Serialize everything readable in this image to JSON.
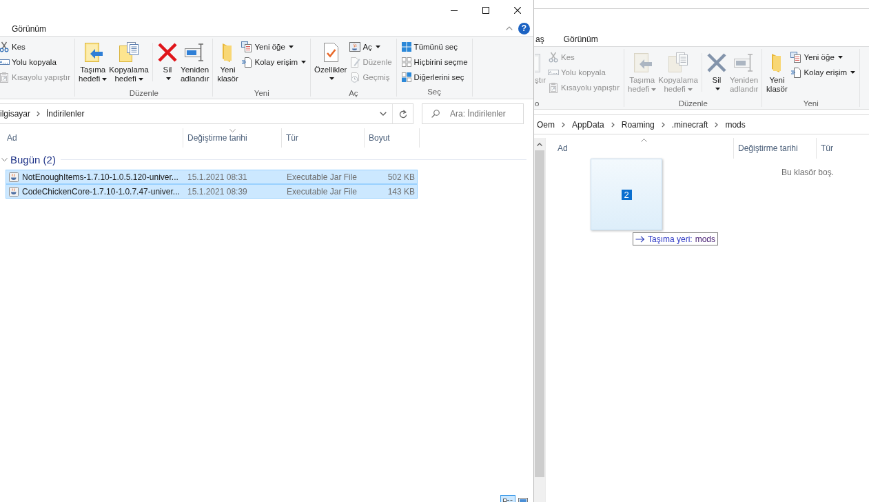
{
  "left_window": {
    "tabs": [
      {
        "label": "Görünüm",
        "selected": false
      }
    ],
    "help_button": {
      "glyph": "?"
    },
    "ribbon": [
      {
        "items": [
          {
            "label": "Kes",
            "kind": "cut",
            "dropdown": false,
            "disabled": false
          },
          {
            "label": "Yolu kopyala",
            "kind": "copypath",
            "dropdown": false,
            "disabled": false
          },
          {
            "label": "Kısayolu yapıştır",
            "kind": "pasteshortcut",
            "dropdown": false,
            "disabled": true
          }
        ]
      },
      {
        "label": "Düzenle",
        "items": [
          {
            "label": "Taşıma hedefi",
            "kind": "moveto",
            "dropdown": true,
            "disabled": false
          },
          {
            "label": "Kopyalama hedefi",
            "kind": "copyto",
            "dropdown": true,
            "disabled": false
          },
          {
            "kind": "separator"
          },
          {
            "label": "Sil",
            "kind": "delete",
            "dropdown": true,
            "disabled": false,
            "icon_disabled": false
          },
          {
            "label": "Yeniden adlandır",
            "kind": "rename",
            "dropdown": false,
            "disabled": false
          }
        ]
      },
      {
        "label": "Yeni",
        "items": [
          {
            "label": "Yeni klasör",
            "kind": "newfolder",
            "dropdown": false,
            "disabled": false
          },
          {
            "label": "Yeni öğe",
            "kind": "newitem",
            "dropdown": true,
            "disabled": false
          },
          {
            "label": "Kolay erişim",
            "kind": "easyaccess",
            "dropdown": true,
            "disabled": false
          }
        ]
      },
      {
        "label": "Aç",
        "items": [
          {
            "label": "Özellikler",
            "kind": "properties",
            "dropdown": true,
            "disabled": false
          },
          {
            "label": "Aç",
            "kind": "open",
            "dropdown": true,
            "disabled": false
          },
          {
            "label": "Düzenle",
            "kind": "edit",
            "dropdown": false,
            "disabled": true
          },
          {
            "label": "Geçmiş",
            "kind": "history",
            "dropdown": false,
            "disabled": true
          }
        ]
      },
      {
        "label": "Seç",
        "items": [
          {
            "label": "Tümünü seç",
            "kind": "selectall",
            "dropdown": false,
            "disabled": false
          },
          {
            "label": "Hiçbirini seçme",
            "kind": "selectnone",
            "dropdown": false,
            "disabled": false
          },
          {
            "label": "Diğerlerini seç",
            "kind": "invertselection",
            "dropdown": false,
            "disabled": false
          }
        ]
      }
    ],
    "address": {
      "path": [
        "ilgisayar",
        "İndirilenler"
      ]
    },
    "search": {
      "placeholder": "Ara: İndirilenler"
    },
    "columns": [
      {
        "label": "Ad",
        "sorted": false
      },
      {
        "label": "Değiştirme tarihi",
        "sorted": true,
        "ascending": false
      },
      {
        "label": "Tür",
        "sorted": false
      },
      {
        "label": "Boyut",
        "sorted": false
      }
    ],
    "groups": [
      {
        "label": "Bugün (2)",
        "expanded": true,
        "rows": [
          {
            "name": "NotEnoughItems-1.7.10-1.0.5.120-univer...",
            "modified": "15.1.2021 08:31",
            "type": "Executable Jar File",
            "size": "502 KB",
            "selected": true
          },
          {
            "name": "CodeChickenCore-1.7.10-1.0.7.47-univer...",
            "modified": "15.1.2021 08:39",
            "type": "Executable Jar File",
            "size": "143 KB",
            "selected": true
          }
        ]
      }
    ],
    "view_buttons": [
      {
        "kind": "details",
        "selected": true
      },
      {
        "kind": "largeicons",
        "selected": false
      }
    ]
  },
  "right_window": {
    "tabs": [
      {
        "label": "aş",
        "selected": false
      },
      {
        "label": "Görünüm",
        "selected": false
      }
    ],
    "ribbon": [
      {
        "label": "o",
        "items": [
          {
            "label": "ştır",
            "kind": "paste",
            "dropdown": false,
            "disabled": true
          },
          {
            "label": "Kes",
            "kind": "cut",
            "dropdown": false,
            "disabled": true
          },
          {
            "label": "Yolu kopyala",
            "kind": "copypath",
            "dropdown": false,
            "disabled": true
          },
          {
            "label": "Kısayolu yapıştır",
            "kind": "pasteshortcut",
            "dropdown": false,
            "disabled": true
          }
        ]
      },
      {
        "label": "Düzenle",
        "items": [
          {
            "label": "Taşıma hedefi",
            "kind": "moveto",
            "dropdown": true,
            "disabled": true
          },
          {
            "label": "Kopyalama hedefi",
            "kind": "copyto",
            "dropdown": true,
            "disabled": true
          },
          {
            "kind": "separator"
          },
          {
            "label": "Sil",
            "kind": "delete",
            "dropdown": true,
            "disabled": false,
            "icon_disabled": true
          },
          {
            "label": "Yeniden adlandır",
            "kind": "rename",
            "dropdown": false,
            "disabled": true
          }
        ]
      },
      {
        "label": "Yeni",
        "items": [
          {
            "label": "Yeni klasör",
            "kind": "newfolder",
            "dropdown": false,
            "disabled": false
          },
          {
            "label": "Yeni öğe",
            "kind": "newitem",
            "dropdown": true,
            "disabled": false
          },
          {
            "label": "Kolay erişim",
            "kind": "easyaccess",
            "dropdown": true,
            "disabled": false
          }
        ]
      }
    ],
    "address": {
      "path": [
        "Oem",
        "AppData",
        "Roaming",
        ".minecraft",
        "mods"
      ]
    },
    "columns": [
      {
        "label": "Ad",
        "sorted": true,
        "ascending": true
      },
      {
        "label": "Değiştirme tarihi",
        "sorted": false
      },
      {
        "label": "Tür",
        "sorted": false
      }
    ],
    "empty_message": "Bu klasör boş.",
    "drag": {
      "count": "2",
      "action": "Taşıma yeri:",
      "target": "mods"
    }
  }
}
